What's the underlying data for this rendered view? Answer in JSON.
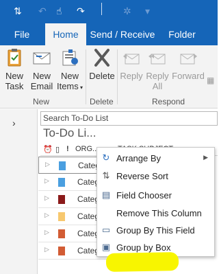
{
  "ribbon_tabs": [
    "File",
    "Home",
    "Send / Receive",
    "Folder"
  ],
  "ribbon": {
    "new_task": "New\nTask",
    "new_email": "New\nEmail",
    "new_items": "New\nItems",
    "delete": "Delete",
    "reply": "Reply",
    "reply_all": "Reply\nAll",
    "forward": "Forward",
    "groups": [
      "New",
      "Delete",
      "Respond"
    ]
  },
  "content": {
    "search_placeholder": "Search To-Do List",
    "list_title": "To-Do Li...",
    "column_org": "ORG...",
    "column_subject": "TASK SUBJECT"
  },
  "rows": [
    {
      "category": "Categ",
      "color": "#4a9fe0"
    },
    {
      "category": "Categ",
      "color": "#4a9fe0"
    },
    {
      "category": "Categ",
      "color": "#8b1a1a"
    },
    {
      "category": "Categ",
      "color": "#f7c86f"
    },
    {
      "category": "Categ",
      "color": "#d25c34"
    },
    {
      "category": "Categ",
      "color": "#d25c34"
    }
  ],
  "context_menu": {
    "items": [
      "Arrange By",
      "Reverse Sort",
      "Field Chooser",
      "Remove This Column",
      "Group By This Field",
      "Group by Box"
    ]
  },
  "colors": {
    "brand_blue": "#1565b8",
    "ribbon_bg": "#f3f3f3",
    "highlight": "#f8f500"
  }
}
